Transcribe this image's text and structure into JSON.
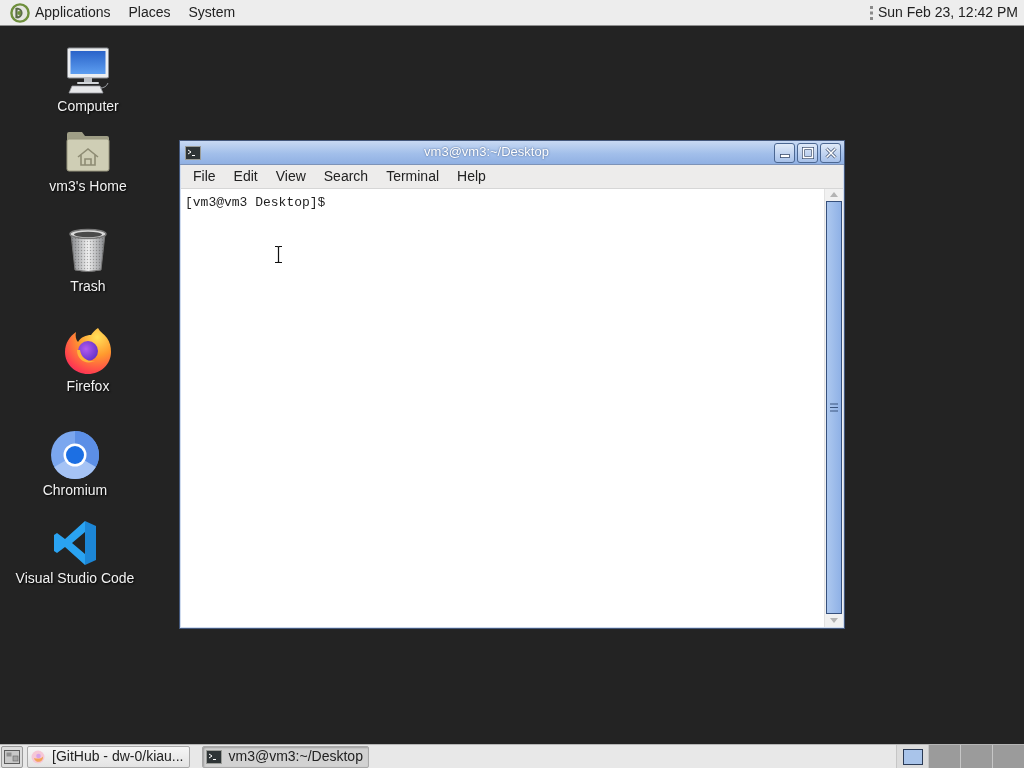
{
  "top_panel": {
    "applications_menu": "Applications",
    "menus": [
      "Places",
      "System"
    ],
    "clock": "Sun Feb 23, 12:42 PM"
  },
  "desktop_icons": [
    {
      "kind": "computer",
      "label": "Computer"
    },
    {
      "kind": "home",
      "label": "vm3's Home"
    },
    {
      "kind": "trash",
      "label": "Trash"
    },
    {
      "kind": "firefox",
      "label": "Firefox"
    },
    {
      "kind": "chromium",
      "label": "Chromium"
    },
    {
      "kind": "vscode",
      "label": "Visual Studio Code"
    }
  ],
  "terminal_window": {
    "title": "vm3@vm3:~/Desktop",
    "menu": [
      "File",
      "Edit",
      "View",
      "Search",
      "Terminal",
      "Help"
    ],
    "prompt": "[vm3@vm3 Desktop]$"
  },
  "taskbar": {
    "tasks": [
      {
        "kind": "browser",
        "label": "[GitHub - dw-0/kiau...",
        "selected": false
      },
      {
        "kind": "terminal",
        "label": "vm3@vm3:~/Desktop",
        "selected": true
      }
    ],
    "workspaces": [
      {
        "selected": true
      },
      {
        "selected": false
      },
      {
        "selected": false
      },
      {
        "selected": false
      }
    ]
  }
}
